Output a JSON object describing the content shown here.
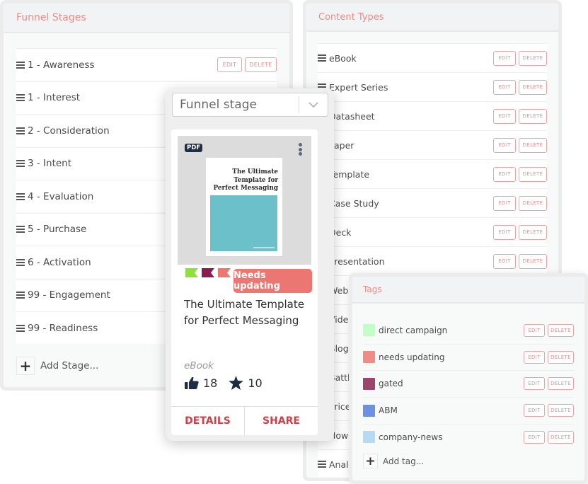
{
  "funnel_stages": {
    "title": "Funnel Stages",
    "items": [
      {
        "label": "1 - Awareness"
      },
      {
        "label": "1 - Interest"
      },
      {
        "label": "2 - Consideration"
      },
      {
        "label": "3 - Intent"
      },
      {
        "label": "4 - Evaluation"
      },
      {
        "label": "5 - Purchase"
      },
      {
        "label": "6 - Activation"
      },
      {
        "label": "99 - Engagement"
      },
      {
        "label": "99 - Readiness"
      }
    ],
    "edit_label": "EDIT",
    "delete_label": "DELETE",
    "add_label": "Add Stage..."
  },
  "content_types": {
    "title": "Content Types",
    "items": [
      {
        "label": "eBook"
      },
      {
        "label": "Expert Series"
      },
      {
        "label": "Datasheet"
      },
      {
        "label": "Paper"
      },
      {
        "label": "Template"
      },
      {
        "label": "Case Study"
      },
      {
        "label": "Deck"
      },
      {
        "label": "Presentation"
      },
      {
        "label": "Webinar"
      },
      {
        "label": "Video"
      },
      {
        "label": "Blog Post"
      },
      {
        "label": "Battlecard"
      },
      {
        "label": "Price"
      },
      {
        "label": "How To"
      },
      {
        "label": "Analyst Report"
      }
    ],
    "edit_label": "EDIT",
    "delete_label": "DELETE"
  },
  "tags": {
    "title": "Tags",
    "items": [
      {
        "label": "direct campaign",
        "color": "#c3fdc7"
      },
      {
        "label": "needs updating",
        "color": "#f08c88"
      },
      {
        "label": "gated",
        "color": "#9c456c"
      },
      {
        "label": "ABM",
        "color": "#6f90e2"
      },
      {
        "label": "company-news",
        "color": "#b5dbf2"
      }
    ],
    "edit_label": "EDIT",
    "delete_label": "DELETE",
    "add_label": "Add tag..."
  },
  "card": {
    "funnel_select_value": "Funnel stage",
    "file_badge": "PDF",
    "doc_title": "The Ultimate Template for Perfect Messaging",
    "tag_flags": [
      {
        "color": "#8fe03c"
      },
      {
        "color": "#8c1c50"
      },
      {
        "color": "#ec7772"
      }
    ],
    "status_badge": "Needs updating",
    "title": "The Ultimate Template for Perfect Messaging",
    "type": "eBook",
    "likes": "18",
    "stars": "10",
    "details_label": "DETAILS",
    "share_label": "SHARE"
  },
  "colors": {
    "accent": "#ef8a85",
    "action_red": "#d33d45",
    "badge_red": "#ec7772",
    "navy": "#1e2e44"
  }
}
